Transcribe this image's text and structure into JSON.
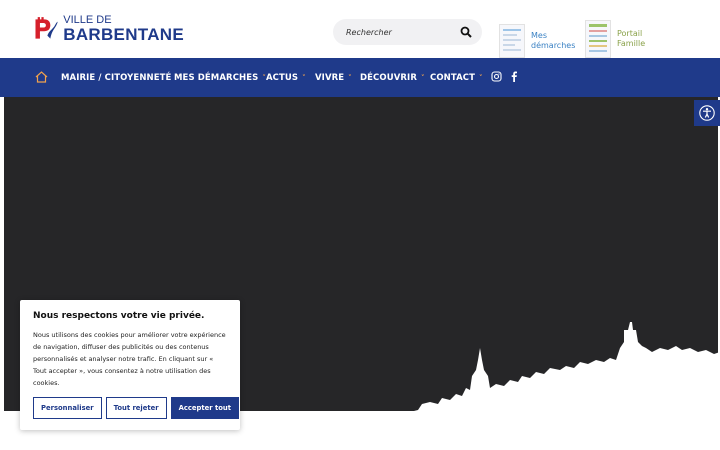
{
  "logo": {
    "line1": "VILLE DE",
    "line2": "BARBENTANE"
  },
  "search": {
    "placeholder": "Rechercher",
    "icon": "search-icon"
  },
  "quicklinks": [
    {
      "line1": "Mes",
      "line2": "démarches"
    },
    {
      "line1": "Portail",
      "line2": "Famille"
    }
  ],
  "nav": {
    "items": [
      "MAIRIE / CITOYENNETÉ",
      "MES DÉMARCHES",
      "ACTUS",
      "VIVRE",
      "DÉCOUVRIR",
      "CONTACT"
    ],
    "chevron": "˅"
  },
  "cookie": {
    "title": "Nous respectons votre vie privée.",
    "text": "Nous utilisons des cookies pour améliorer votre expérience de navigation, diffuser des publicités ou des contenus personnalisés et analyser notre trafic. En cliquant sur « Tout accepter », vous consentez à notre utilisation des cookies.",
    "customize": "Personnaliser",
    "reject": "Tout rejeter",
    "accept": "Accepter tout"
  },
  "colors": {
    "brand": "#1f3a8a",
    "accent": "#f1a24d",
    "hero": "#262628"
  }
}
